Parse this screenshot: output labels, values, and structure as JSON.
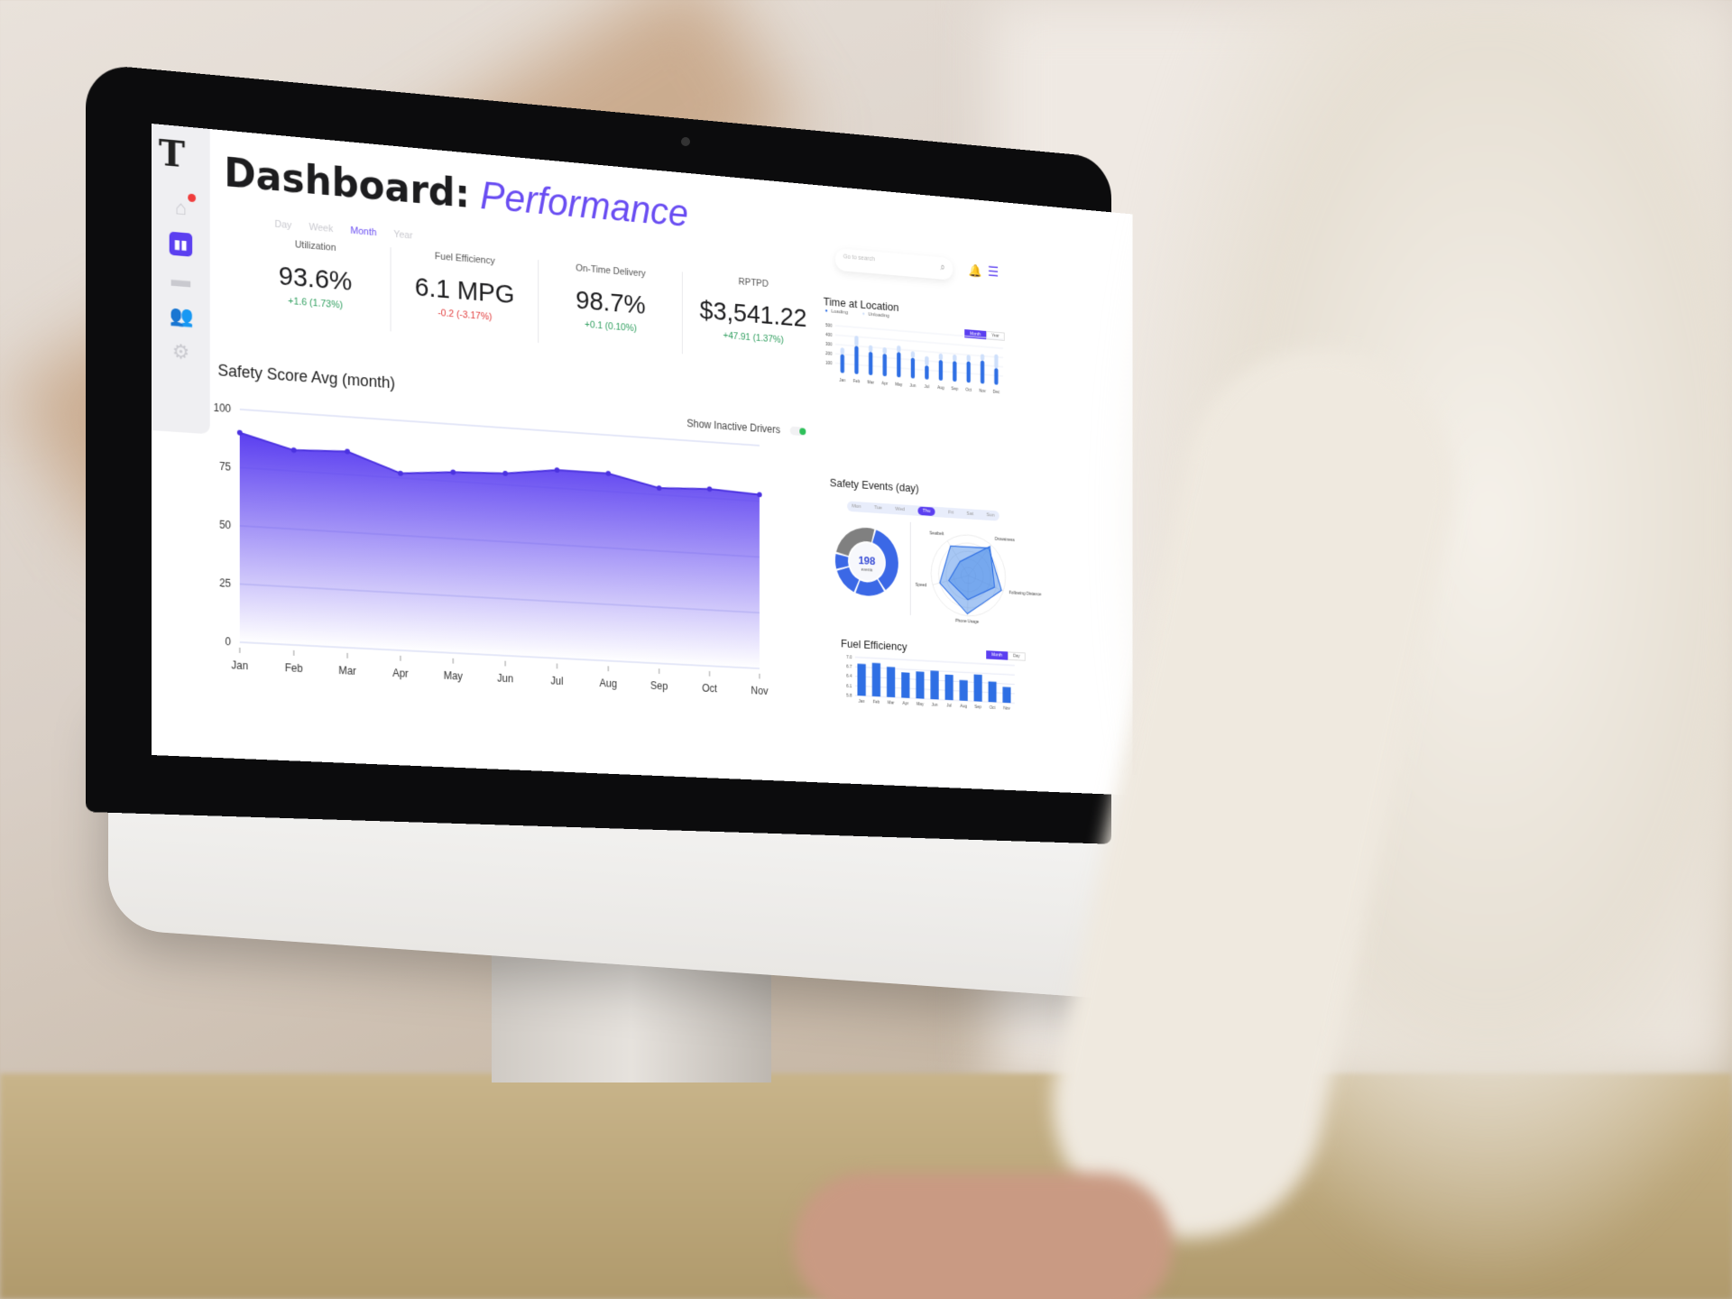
{
  "app": {
    "logo": "T"
  },
  "sidebar": {
    "items": [
      {
        "name": "home",
        "icon": "home-icon",
        "glyph": "⌂",
        "badge": true
      },
      {
        "name": "analytics",
        "icon": "bar-chart-icon",
        "glyph": "▮▮",
        "active": true
      },
      {
        "name": "messages",
        "icon": "chat-icon",
        "glyph": "▬"
      },
      {
        "name": "users",
        "icon": "users-icon",
        "glyph": "👥"
      },
      {
        "name": "settings",
        "icon": "gear-icon",
        "glyph": "⚙"
      }
    ]
  },
  "header": {
    "title": "Dashboard:",
    "subtitle": "Performance",
    "search_placeholder": "Go to search",
    "search_icon": "⌕",
    "bell": "🔔",
    "menu": "☰"
  },
  "period_tabs": [
    {
      "label": "Day"
    },
    {
      "label": "Week"
    },
    {
      "label": "Month",
      "active": true
    },
    {
      "label": "Year"
    }
  ],
  "kpis": [
    {
      "label": "Utilization",
      "value": "93.6%",
      "change": "+1.6 (1.73%)",
      "trend": "up"
    },
    {
      "label": "Fuel Efficiency",
      "value": "6.1 MPG",
      "change": "-0.2 (-3.17%)",
      "trend": "down"
    },
    {
      "label": "On-Time Delivery",
      "value": "98.7%",
      "change": "+0.1 (0.10%)",
      "trend": "up"
    },
    {
      "label": "RPTPD",
      "value": "$3,541.22",
      "change": "+47.91 (1.37%)",
      "trend": "up"
    }
  ],
  "safety_score": {
    "title": "Safety Score Avg (month)",
    "toggle_label": "Show Inactive Drivers",
    "toggle_on": true
  },
  "time_at_location": {
    "title": "Time at Location",
    "legend": [
      "Loading",
      "Unloading"
    ],
    "segments": [
      "Month",
      "Year"
    ],
    "active": "Month"
  },
  "safety_events": {
    "title": "Safety Events (day)",
    "days": [
      "Mon",
      "Tue",
      "Wed",
      "Thu",
      "Fri",
      "Sat",
      "Sun"
    ],
    "active_day": "Thu",
    "total": "198",
    "total_label": "events"
  },
  "fuel_efficiency": {
    "title": "Fuel Efficiency",
    "segments": [
      "Month",
      "Day"
    ],
    "active": "Month"
  },
  "colors": {
    "accent": "#5b3ff0",
    "bar": "#2f6fe4",
    "bar_light": "#cfe0fb",
    "up": "#2e9e5e",
    "down": "#e23c3c",
    "donut_gray": "#808080"
  },
  "chart_data": [
    {
      "type": "area",
      "title": "Safety Score Avg (month)",
      "categories": [
        "Jan",
        "Feb",
        "Mar",
        "Apr",
        "May",
        "Jun",
        "Jul",
        "Aug",
        "Sep",
        "Oct",
        "Nov"
      ],
      "values": [
        90,
        84,
        85,
        77,
        79,
        80,
        83,
        83,
        78,
        79,
        78
      ],
      "yticks": [
        0,
        25,
        50,
        75,
        100
      ],
      "ylim": [
        0,
        100
      ],
      "grid": true
    },
    {
      "type": "bar",
      "title": "Time at Location",
      "stacked": true,
      "categories": [
        "Jan",
        "Feb",
        "Mar",
        "Apr",
        "May",
        "Jun",
        "Jul",
        "Aug",
        "Sep",
        "Oct",
        "Nov",
        "Dec"
      ],
      "series": [
        {
          "name": "Loading",
          "values": [
            200,
            300,
            250,
            240,
            270,
            220,
            150,
            220,
            220,
            230,
            250,
            180
          ]
        },
        {
          "name": "Unloading",
          "values": [
            70,
            110,
            70,
            70,
            70,
            70,
            100,
            70,
            70,
            70,
            70,
            150
          ]
        }
      ],
      "yticks": [
        100,
        200,
        300,
        400,
        500
      ],
      "ylim": [
        0,
        500
      ],
      "legend": "top-left"
    },
    {
      "type": "pie",
      "title": "Safety Events (day)",
      "donut": true,
      "center_label": "198",
      "values": [
        0.36,
        0.16,
        0.14,
        0.08,
        0.26
      ],
      "colors": [
        "#3b68e6",
        "#3b68e6",
        "#3b68e6",
        "#3b68e6",
        "#808080"
      ]
    },
    {
      "type": "radar",
      "axes": [
        "Seatbelt",
        "Drowsiness",
        "Following Distance",
        "Phone Usage",
        "Speed"
      ],
      "series": [
        {
          "values": [
            0.85,
            0.9,
            0.95,
            0.95,
            0.8
          ]
        },
        {
          "values": [
            0.4,
            0.95,
            0.75,
            0.6,
            0.55
          ]
        }
      ]
    },
    {
      "type": "bar",
      "title": "Fuel Efficiency",
      "categories": [
        "Jan",
        "Feb",
        "Mar",
        "Apr",
        "May",
        "Jun",
        "Jul",
        "Aug",
        "Sep",
        "Oct",
        "Nov"
      ],
      "values": [
        6.8,
        6.85,
        6.75,
        6.6,
        6.65,
        6.7,
        6.6,
        6.45,
        6.65,
        6.45,
        6.3
      ],
      "yticks": [
        5.8,
        6.1,
        6.4,
        6.7,
        7.0
      ],
      "ylim": [
        5.8,
        7.0
      ]
    }
  ]
}
